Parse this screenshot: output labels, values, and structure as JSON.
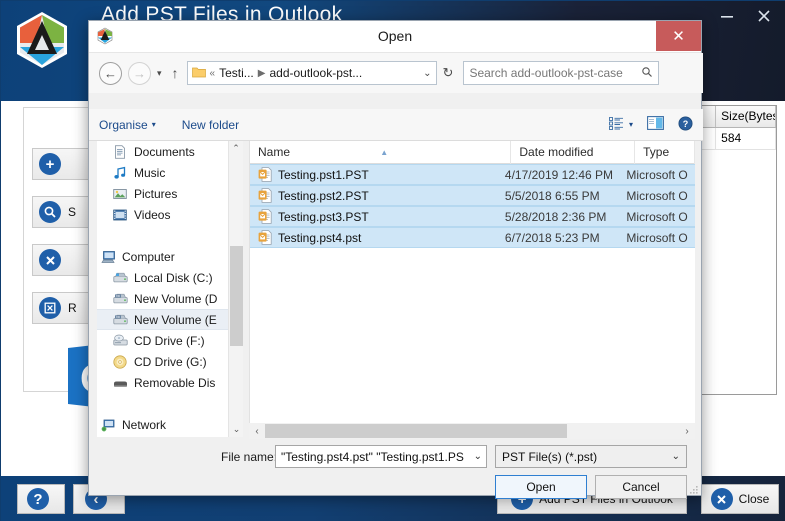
{
  "app": {
    "title": "Add PST Files in Outlook",
    "logo_icon": "app-hexagon-logo",
    "window_controls": {
      "minimize": "minimize-icon",
      "close": "close-icon"
    },
    "sidebar_buttons": [
      {
        "icon": "plus-circle-icon",
        "label": ""
      },
      {
        "icon": "search-circle-icon",
        "label": "S"
      },
      {
        "icon": "x-circle-icon",
        "label": ""
      },
      {
        "icon": "remove-box-icon",
        "label": "R"
      }
    ],
    "outlook_graphic": "outlook-logo-graphic",
    "grid": {
      "headers": [
        "Size(Bytes)"
      ],
      "rows": [
        [
          "584"
        ]
      ]
    },
    "footer_buttons": [
      {
        "name": "help",
        "label": "",
        "icon": "question-circle-icon"
      },
      {
        "name": "back",
        "label": "",
        "icon": "back-circle-icon"
      },
      {
        "name": "add-pst",
        "label": "Add PST Files in Outlook",
        "icon": "add-circle-icon"
      },
      {
        "name": "close",
        "label": "Close",
        "icon": "close-circle-icon"
      }
    ]
  },
  "dialog": {
    "title": "Open",
    "title_icon": "app-hexagon-icon",
    "close_label": "✕",
    "nav": {
      "back_icon": "arrow-left-icon",
      "forward_icon": "arrow-right-icon",
      "recent_icon": "chevron-down-icon",
      "up_icon": "arrow-up-icon",
      "breadcrumb": [
        "Testi...",
        "add-outlook-pst..."
      ],
      "breadcrumb_prefix": "«",
      "breadcrumb_dropdown": "⌄",
      "refresh_icon": "refresh-icon",
      "search_placeholder": "Search add-outlook-pst-case",
      "search_value": "",
      "search_icon": "search-icon"
    },
    "toolbar": {
      "organise_label": "Organise",
      "organise_caret": "▾",
      "new_folder_label": "New folder",
      "view_icon": "view-list-icon",
      "view_caret": "▾",
      "pane_icon": "preview-pane-icon",
      "help_icon": "help-circle-icon"
    },
    "nav_pane": {
      "items": [
        {
          "label": "Documents",
          "icon": "documents-icon",
          "level": 1,
          "selected": false
        },
        {
          "label": "Music",
          "icon": "music-icon",
          "level": 1,
          "selected": false
        },
        {
          "label": "Pictures",
          "icon": "pictures-icon",
          "level": 1,
          "selected": false
        },
        {
          "label": "Videos",
          "icon": "videos-icon",
          "level": 1,
          "selected": false
        },
        {
          "label": "",
          "icon": "",
          "level": 1,
          "selected": false
        },
        {
          "label": "Computer",
          "icon": "computer-icon",
          "level": 0,
          "selected": false
        },
        {
          "label": "Local Disk (C:)",
          "icon": "local-disk-icon",
          "level": 1,
          "selected": false
        },
        {
          "label": "New Volume (D",
          "icon": "volume-icon",
          "level": 1,
          "selected": false
        },
        {
          "label": "New Volume (E",
          "icon": "volume-icon",
          "level": 1,
          "selected": true
        },
        {
          "label": "CD Drive (F:)",
          "icon": "cd-drive-icon",
          "level": 1,
          "selected": false
        },
        {
          "label": "CD Drive (G:)",
          "icon": "cd-disc-icon",
          "level": 1,
          "selected": false
        },
        {
          "label": "Removable Dis",
          "icon": "removable-disk-icon",
          "level": 1,
          "selected": false
        },
        {
          "label": "",
          "icon": "",
          "level": 1,
          "selected": false
        },
        {
          "label": "Network",
          "icon": "network-icon",
          "level": 0,
          "selected": false
        }
      ],
      "scroll_up": "⌃",
      "scroll_down": "⌄"
    },
    "file_list": {
      "columns": [
        "Name",
        "Date modified",
        "Type"
      ],
      "sort_indicator": "▲",
      "rows": [
        {
          "name": "Testing.pst1.PST",
          "date": "4/17/2019 12:46 PM",
          "type": "Microsoft O",
          "icon": "pst-file-icon",
          "selected": true
        },
        {
          "name": "Testing.pst2.PST",
          "date": "5/5/2018 6:55 PM",
          "type": "Microsoft O",
          "icon": "pst-file-icon",
          "selected": true
        },
        {
          "name": "Testing.pst3.PST",
          "date": "5/28/2018 2:36 PM",
          "type": "Microsoft O",
          "icon": "pst-file-icon",
          "selected": true
        },
        {
          "name": "Testing.pst4.pst",
          "date": "6/7/2018 5:23 PM",
          "type": "Microsoft O",
          "icon": "pst-file-icon",
          "selected": true
        }
      ],
      "h_scroll_left": "‹",
      "h_scroll_right": "›"
    },
    "bottom": {
      "filename_label": "File name:",
      "filename_value": "\"Testing.pst4.pst\" \"Testing.pst1.PS",
      "filename_caret": "⌄",
      "filetype_value": "PST File(s) (*.pst)",
      "filetype_caret": "⌄",
      "open_label": "Open",
      "cancel_label": "Cancel",
      "grip_icon": "resize-grip-icon"
    }
  },
  "colors": {
    "title_blue": "#0d4179",
    "dialog_close_red": "#c75b5b",
    "selection_blue": "#cfe6f7",
    "link_blue": "#1c4b8b",
    "accent_blue": "#1f5fa9"
  }
}
